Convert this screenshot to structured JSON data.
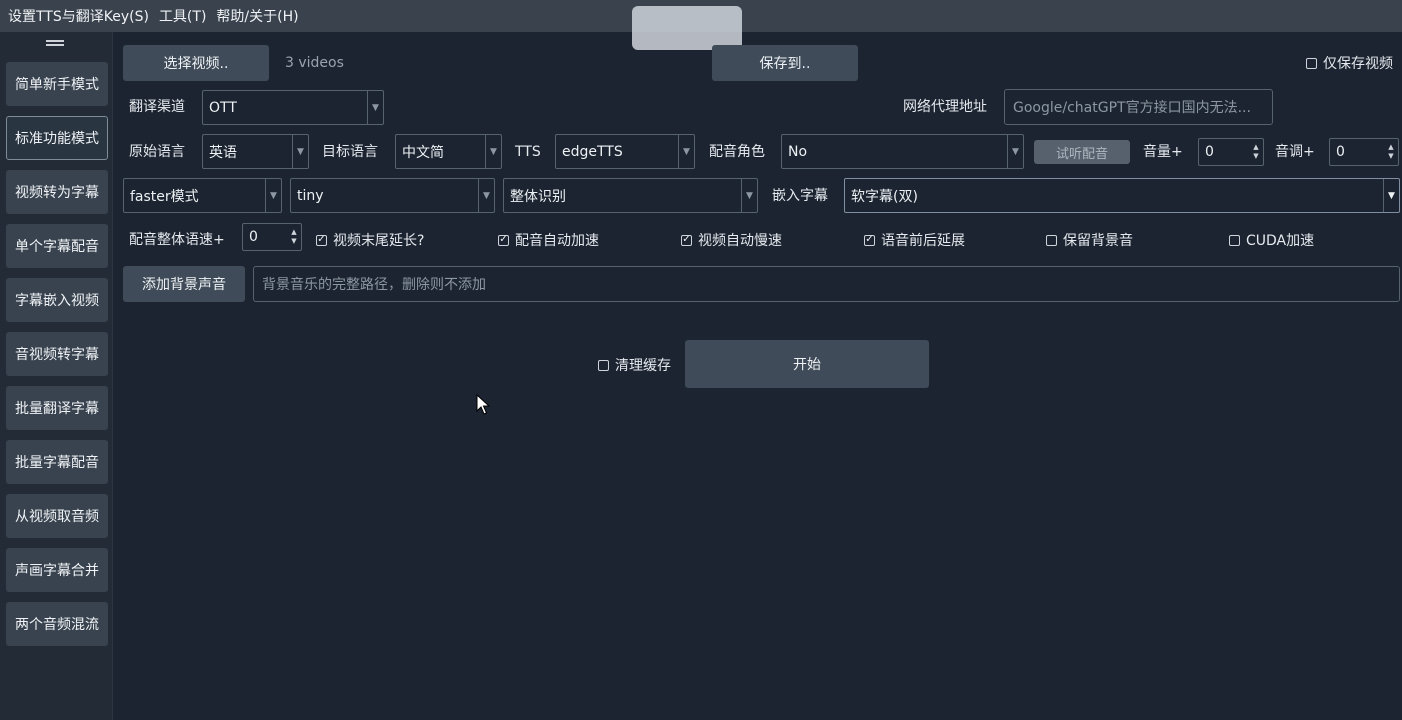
{
  "menubar": {
    "items": [
      "设置TTS与翻译Key(S)",
      "工具(T)",
      "帮助/关于(H)"
    ]
  },
  "sidebar": {
    "items": [
      "简单新手模式",
      "标准功能模式",
      "视频转为字幕",
      "单个字幕配音",
      "字幕嵌入视频",
      "音视频转字幕",
      "批量翻译字幕",
      "批量字幕配音",
      "从视频取音频",
      "声画字幕合并",
      "两个音频混流"
    ],
    "active_index": 1
  },
  "top": {
    "select_video": "选择视频..",
    "video_count": "3 videos",
    "save_to": "保存到..",
    "only_save_video": "仅保存视频"
  },
  "row1": {
    "channel_label": "翻译渠道",
    "channel_value": "OTT",
    "proxy_label": "网络代理地址",
    "proxy_placeholder": "Google/chatGPT官方接口国内无法..."
  },
  "row2": {
    "source_label": "原始语言",
    "source_value": "英语",
    "target_label": "目标语言",
    "target_value": "中文简",
    "tts_label": "TTS",
    "tts_value": "edgeTTS",
    "role_label": "配音角色",
    "role_value": "No",
    "listen_button": "试听配音",
    "volume_label": "音量+",
    "volume_value": "0",
    "pitch_label": "音调+",
    "pitch_value": "0"
  },
  "row3": {
    "mode_value": "faster模式",
    "model_value": "tiny",
    "recognition_value": "整体识别",
    "embed_label": "嵌入字幕",
    "embed_value": "软字幕(双)"
  },
  "row4": {
    "speed_label": "配音整体语速+",
    "speed_value": "0",
    "checks": [
      {
        "label": "视频末尾延长?",
        "checked": true
      },
      {
        "label": "配音自动加速",
        "checked": true
      },
      {
        "label": "视频自动慢速",
        "checked": true
      },
      {
        "label": "语音前后延展",
        "checked": true
      },
      {
        "label": "保留背景音",
        "checked": false
      },
      {
        "label": "CUDA加速",
        "checked": false
      }
    ]
  },
  "row5": {
    "add_bg_button": "添加背景声音",
    "bg_placeholder": "背景音乐的完整路径，删除则不添加"
  },
  "bottom": {
    "clear_cache": "清理缓存",
    "clear_cache_checked": false,
    "start_button": "开始"
  },
  "colors": {
    "background": "#1b2430",
    "menubar": "#39424d",
    "button": "#3f4b58",
    "border": "#57626f"
  }
}
